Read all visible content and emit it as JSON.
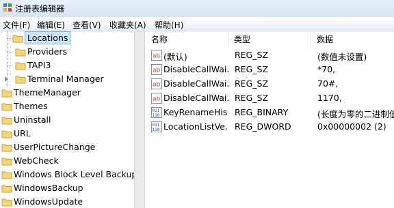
{
  "window": {
    "title": "注册表编辑器"
  },
  "menu": [
    {
      "label": "文件(F)"
    },
    {
      "label": "编辑(E)"
    },
    {
      "label": "查看(V)"
    },
    {
      "label": "收藏夹(A)"
    },
    {
      "label": "帮助(H)"
    }
  ],
  "tree": [
    {
      "label": "Locations",
      "selected": true
    },
    {
      "label": "Providers"
    },
    {
      "label": "TAPI3"
    },
    {
      "label": "Terminal Manager"
    },
    {
      "label": "ThemeManager"
    },
    {
      "label": "Themes"
    },
    {
      "label": "Uninstall"
    },
    {
      "label": "URL"
    },
    {
      "label": "UserPictureChange"
    },
    {
      "label": "WebCheck"
    },
    {
      "label": "Windows Block Level Backup"
    },
    {
      "label": "WindowsBackup"
    },
    {
      "label": "WindowsUpdate"
    }
  ],
  "columns": {
    "name": "名称",
    "type": "类型",
    "data": "数据"
  },
  "values": [
    {
      "icon": "string-value-icon",
      "name": "(默认)",
      "type": "REG_SZ",
      "data": "(数值未设置)"
    },
    {
      "icon": "string-value-icon",
      "name": "DisableCallWai...",
      "type": "REG_SZ",
      "data": "*70,"
    },
    {
      "icon": "string-value-icon",
      "name": "DisableCallWai...",
      "type": "REG_SZ",
      "data": "70#,"
    },
    {
      "icon": "string-value-icon",
      "name": "DisableCallWai...",
      "type": "REG_SZ",
      "data": "1170,"
    },
    {
      "icon": "binary-value-icon",
      "name": "KeyRenameHis...",
      "type": "REG_BINARY",
      "data": "(长度为零的二进制值)"
    },
    {
      "icon": "binary-value-icon",
      "name": "LocationListVe...",
      "type": "REG_DWORD",
      "data": "0x00000002 (2)"
    }
  ]
}
